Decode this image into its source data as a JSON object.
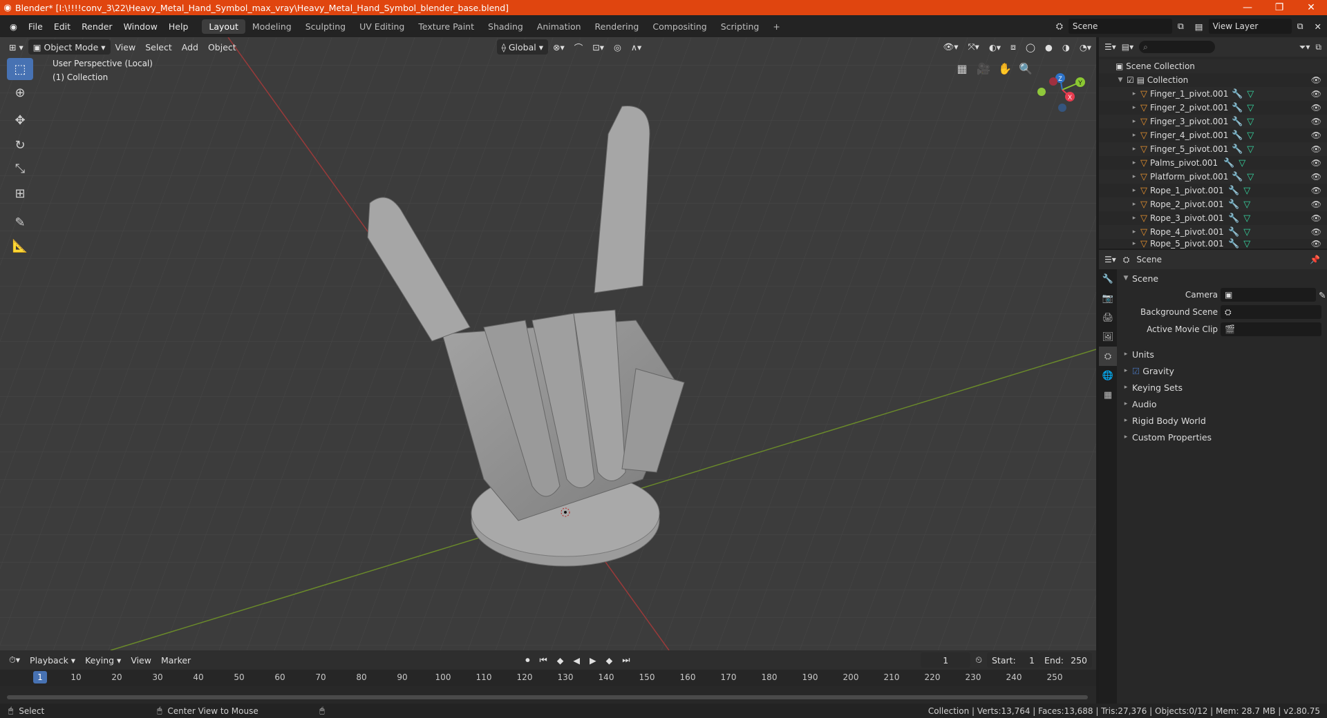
{
  "titlebar": {
    "title": "Blender* [I:\\!!!!conv_3\\22\\Heavy_Metal_Hand_Symbol_max_vray\\Heavy_Metal_Hand_Symbol_blender_base.blend]",
    "minimize": "—",
    "restore": "❐",
    "close": "✕"
  },
  "menu": {
    "items": [
      "File",
      "Edit",
      "Render",
      "Window",
      "Help"
    ],
    "workspaces": [
      "Layout",
      "Modeling",
      "Sculpting",
      "UV Editing",
      "Texture Paint",
      "Shading",
      "Animation",
      "Rendering",
      "Compositing",
      "Scripting"
    ],
    "add_workspace": "+",
    "scene": "Scene",
    "view_layer": "View Layer"
  },
  "viewport": {
    "mode": "Object Mode",
    "menus": [
      "View",
      "Select",
      "Add",
      "Object"
    ],
    "orientation": "Global",
    "info_line1": "User Perspective (Local)",
    "info_line2": "(1) Collection",
    "gizmo": {
      "x": "X",
      "y": "Y",
      "z": "Z"
    }
  },
  "outliner": {
    "search_placeholder": "",
    "scene_collection": "Scene Collection",
    "collection": "Collection",
    "objects": [
      "Finger_1_pivot.001",
      "Finger_2_pivot.001",
      "Finger_3_pivot.001",
      "Finger_4_pivot.001",
      "Finger_5_pivot.001",
      "Palms_pivot.001",
      "Platform_pivot.001",
      "Rope_1_pivot.001",
      "Rope_2_pivot.001",
      "Rope_3_pivot.001",
      "Rope_4_pivot.001",
      "Rope_5_pivot.001"
    ]
  },
  "properties": {
    "context": "Scene",
    "panel_title": "Scene",
    "camera_label": "Camera",
    "background_scene_label": "Background Scene",
    "active_movie_clip_label": "Active Movie Clip",
    "panels": [
      "Units",
      "Gravity",
      "Keying Sets",
      "Audio",
      "Rigid Body World",
      "Custom Properties"
    ]
  },
  "timeline": {
    "menus": [
      "Playback",
      "Keying",
      "View",
      "Marker"
    ],
    "current_frame": "1",
    "start_label": "Start:",
    "start": "1",
    "end_label": "End:",
    "end": "250",
    "ticks": [
      "1",
      "10",
      "20",
      "30",
      "40",
      "50",
      "60",
      "70",
      "80",
      "90",
      "100",
      "110",
      "120",
      "130",
      "140",
      "150",
      "160",
      "170",
      "180",
      "190",
      "200",
      "210",
      "220",
      "230",
      "240",
      "250"
    ]
  },
  "statusbar": {
    "select": "Select",
    "center_view": "Center View to Mouse",
    "stats": "Collection | Verts:13,764 | Faces:13,688 | Tris:27,376 | Objects:0/12 | Mem: 28.7 MB | v2.80.75"
  }
}
